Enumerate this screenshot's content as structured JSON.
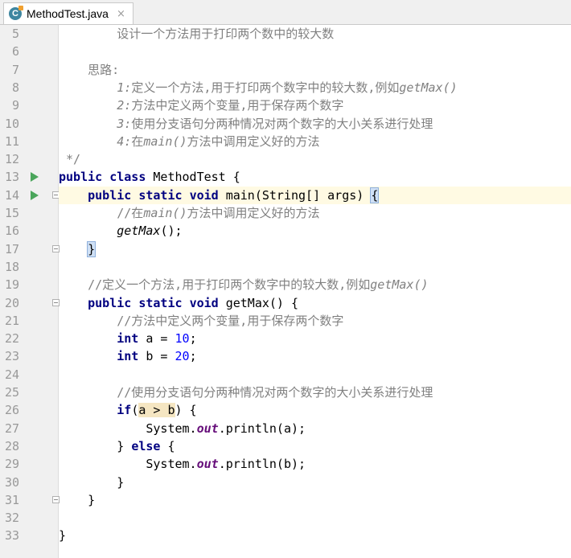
{
  "tab": {
    "label": "MethodTest.java",
    "icon": "java-class-icon",
    "close": "×"
  },
  "lines": [
    {
      "num": "5",
      "text": "        设计一个方法用于打印两个数中的较大数"
    },
    {
      "num": "6",
      "text": ""
    },
    {
      "num": "7",
      "text": "    思路:"
    },
    {
      "num": "8",
      "text": "        1:定义一个方法,用于打印两个数字中的较大数,例如getMax()"
    },
    {
      "num": "9",
      "text": "        2:方法中定义两个变量,用于保存两个数字"
    },
    {
      "num": "10",
      "text": "        3:使用分支语句分两种情况对两个数字的大小关系进行处理"
    },
    {
      "num": "11",
      "text": "        4:在main()方法中调用定义好的方法"
    },
    {
      "num": "12",
      "text": " */"
    },
    {
      "num": "13",
      "text": "public class MethodTest {"
    },
    {
      "num": "14",
      "text": "    public static void main(String[] args) {"
    },
    {
      "num": "15",
      "text": "        //在main()方法中调用定义好的方法"
    },
    {
      "num": "16",
      "text": "        getMax();"
    },
    {
      "num": "17",
      "text": "    }"
    },
    {
      "num": "18",
      "text": ""
    },
    {
      "num": "19",
      "text": "    //定义一个方法,用于打印两个数字中的较大数,例如getMax()"
    },
    {
      "num": "20",
      "text": "    public static void getMax() {"
    },
    {
      "num": "21",
      "text": "        //方法中定义两个变量,用于保存两个数字"
    },
    {
      "num": "22",
      "text": "        int a = 10;"
    },
    {
      "num": "23",
      "text": "        int b = 20;"
    },
    {
      "num": "24",
      "text": ""
    },
    {
      "num": "25",
      "text": "        //使用分支语句分两种情况对两个数字的大小关系进行处理"
    },
    {
      "num": "26",
      "text": "        if(a > b) {"
    },
    {
      "num": "27",
      "text": "            System.out.println(a);"
    },
    {
      "num": "28",
      "text": "        } else {"
    },
    {
      "num": "29",
      "text": "            System.out.println(b);"
    },
    {
      "num": "30",
      "text": "        }"
    },
    {
      "num": "31",
      "text": "    }"
    },
    {
      "num": "32",
      "text": ""
    },
    {
      "num": "33",
      "text": "}"
    }
  ],
  "colors": {
    "keyword": "#000080",
    "comment": "#808080",
    "number": "#0000ff",
    "field": "#660e7a",
    "current_line": "#fffae3",
    "run_icon": "#4aa55b"
  }
}
